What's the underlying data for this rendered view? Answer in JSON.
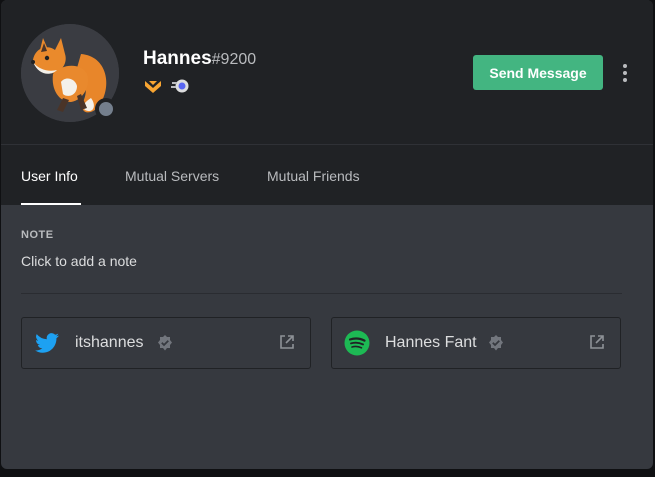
{
  "profile": {
    "username": "Hannes",
    "discriminator": "#9200",
    "status": "offline",
    "badges": [
      {
        "icon": "hypesquad-bravery-icon",
        "color": "#f8a532"
      },
      {
        "icon": "nitro-boost-icon",
        "color": "#b9bbbe"
      }
    ]
  },
  "actions": {
    "send_message_label": "Send Message",
    "send_message_color": "#43b581"
  },
  "tabs": [
    {
      "label": "User Info",
      "active": true
    },
    {
      "label": "Mutual Servers",
      "active": false
    },
    {
      "label": "Mutual Friends",
      "active": false
    }
  ],
  "note": {
    "label": "NOTE",
    "placeholder": "Click to add a note"
  },
  "connections": [
    {
      "service": "twitter",
      "icon": "twitter-icon",
      "color": "#1da1f2",
      "name": "itshannes",
      "verified": true
    },
    {
      "service": "spotify",
      "icon": "spotify-icon",
      "color": "#1db954",
      "name": "Hannes Fant",
      "verified": true
    }
  ]
}
